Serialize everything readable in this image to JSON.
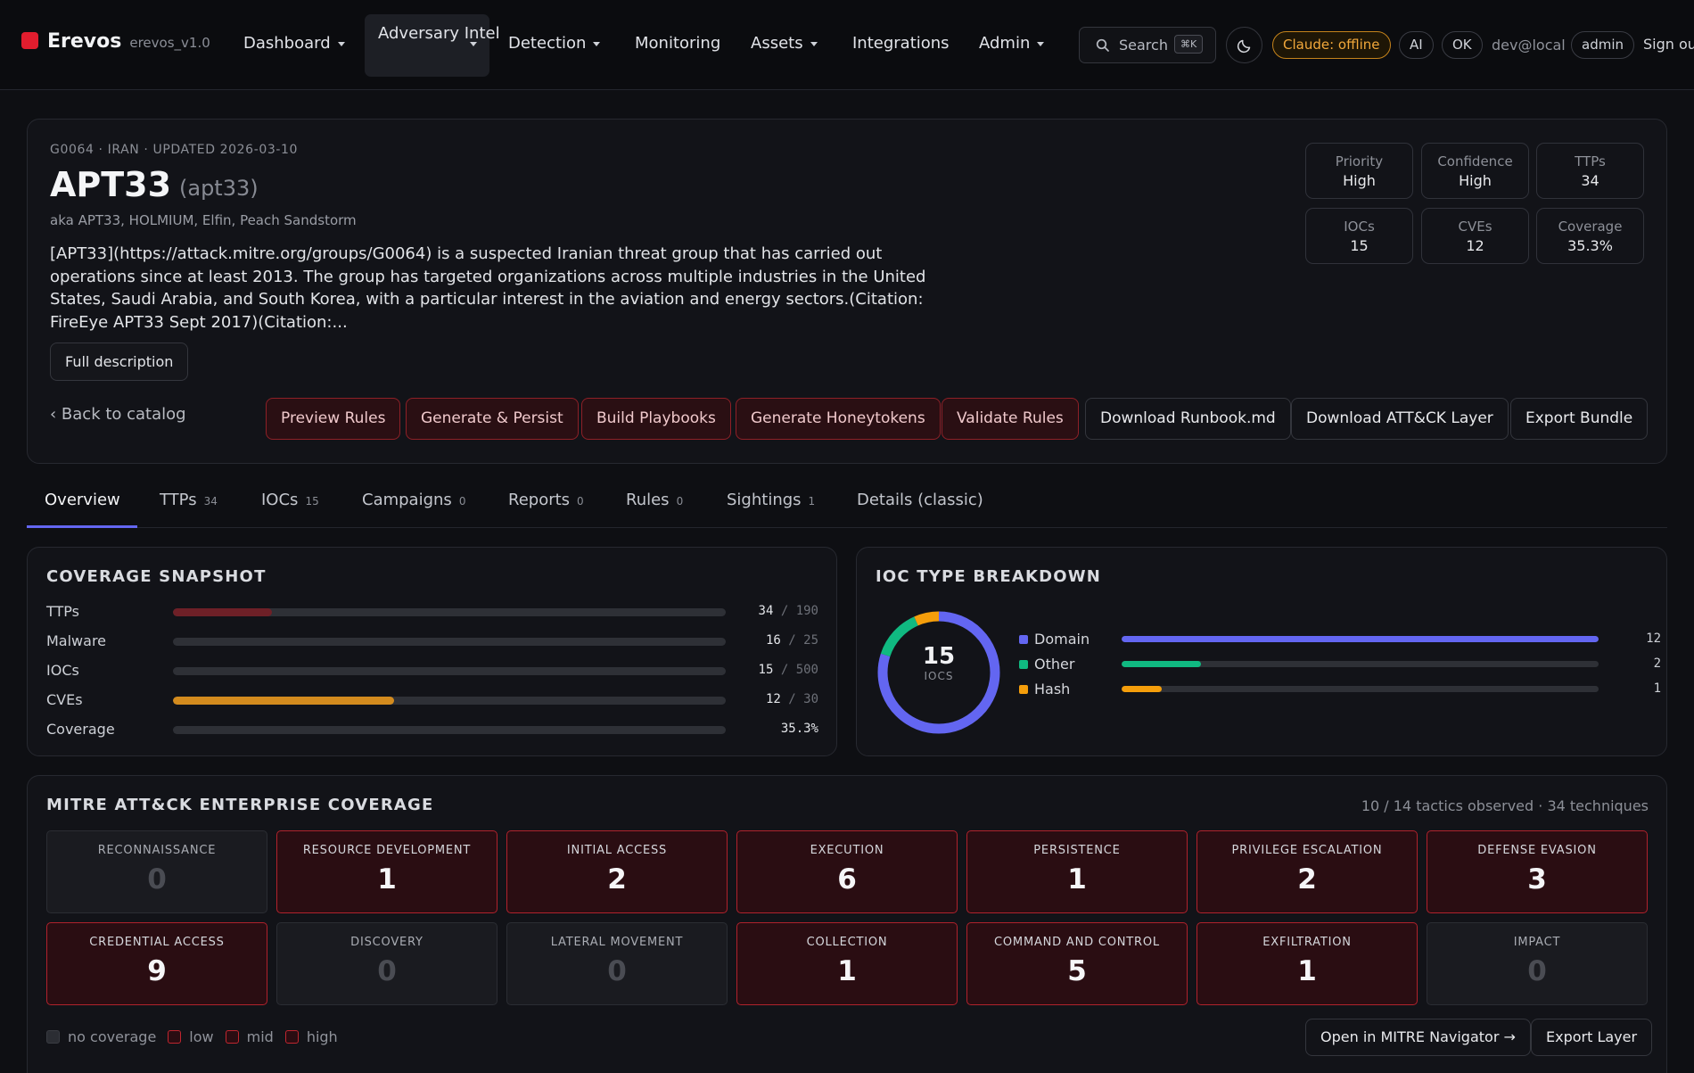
{
  "nav": {
    "brand": "Erevos",
    "version": "erevos_v1.0",
    "items": [
      {
        "label": "Dashboard"
      },
      {
        "label": "Adversary Intel"
      },
      {
        "label": "Detection"
      },
      {
        "label": "Monitoring"
      },
      {
        "label": "Assets"
      },
      {
        "label": "Integrations"
      },
      {
        "label": "Admin"
      }
    ],
    "search_label": "Search",
    "search_kbd": "⌘K",
    "claude_status": "Claude: offline",
    "ai_label": "AI",
    "ok_label": "OK",
    "user": "dev@local",
    "role": "admin",
    "signout": "Sign ou"
  },
  "actor": {
    "meta": "G0064 · IRAN · UPDATED 2026-03-10",
    "name": "APT33",
    "slug": "(apt33)",
    "aka": "aka APT33, HOLMIUM, Elfin, Peach Sandstorm",
    "description": "[APT33](https://attack.mitre.org/groups/G0064) is a suspected Iranian threat group that has carried out operations since at least 2013. The group has targeted organizations across multiple industries in the United States, Saudi Arabia, and South Korea, with a particular interest in the aviation and energy sectors.(Citation: FireEye APT33 Sept 2017)(Citation:...",
    "full_desc_label": "Full description",
    "back_label": "‹ Back to catalog",
    "stats": [
      {
        "label": "Priority",
        "value": "High"
      },
      {
        "label": "Confidence",
        "value": "High"
      },
      {
        "label": "TTPs",
        "value": "34"
      },
      {
        "label": "IOCs",
        "value": "15"
      },
      {
        "label": "CVEs",
        "value": "12"
      },
      {
        "label": "Coverage",
        "value": "35.3%"
      }
    ],
    "actions": [
      {
        "label": "Preview Rules"
      },
      {
        "label": "Generate & Persist"
      },
      {
        "label": "Build Playbooks"
      },
      {
        "label": "Generate Honeytokens"
      },
      {
        "label": "Validate Rules"
      },
      {
        "label": "Download Runbook.md"
      },
      {
        "label": "Download ATT&CK Layer"
      },
      {
        "label": "Export Bundle"
      }
    ]
  },
  "tabs": [
    {
      "label": "Overview",
      "count": ""
    },
    {
      "label": "TTPs",
      "count": "34"
    },
    {
      "label": "IOCs",
      "count": "15"
    },
    {
      "label": "Campaigns",
      "count": "0"
    },
    {
      "label": "Reports",
      "count": "0"
    },
    {
      "label": "Rules",
      "count": "0"
    },
    {
      "label": "Sightings",
      "count": "1"
    },
    {
      "label": "Details (classic)",
      "count": ""
    }
  ],
  "coverage": {
    "title": "COVERAGE SNAPSHOT",
    "rows": [
      {
        "label": "TTPs",
        "value": "34",
        "sep": "/",
        "total": "190",
        "fraction": 0.179,
        "color": "#6e2027"
      },
      {
        "label": "Malware",
        "value": "16",
        "sep": "/",
        "total": "25",
        "fraction": 0,
        "color": "#6e2027"
      },
      {
        "label": "IOCs",
        "value": "15",
        "sep": "/",
        "total": "500",
        "fraction": 0,
        "color": "#6e2027"
      },
      {
        "label": "CVEs",
        "value": "12",
        "sep": "/",
        "total": "30",
        "fraction": 0.4,
        "color": "#d38b1e"
      },
      {
        "label": "Coverage",
        "value": "35.3%",
        "sep": "",
        "total": "",
        "fraction": 0,
        "color": "#6e2027"
      }
    ]
  },
  "ioc": {
    "title": "IOC TYPE BREAKDOWN",
    "total": "15",
    "total_label": "IOCS",
    "types": [
      {
        "label": "Domain",
        "count": 12,
        "color": "#6366f1"
      },
      {
        "label": "Other",
        "count": 2,
        "color": "#10b981"
      },
      {
        "label": "Hash",
        "count": 1,
        "color": "#f59e0b"
      }
    ]
  },
  "mitre": {
    "title": "MITRE ATT&CK ENTERPRISE COVERAGE",
    "summary": "10 / 14 tactics observed · 34 techniques",
    "tactics": [
      {
        "name": "RECONNAISSANCE",
        "count": "0"
      },
      {
        "name": "RESOURCE DEVELOPMENT",
        "count": "1"
      },
      {
        "name": "INITIAL ACCESS",
        "count": "2"
      },
      {
        "name": "EXECUTION",
        "count": "6"
      },
      {
        "name": "PERSISTENCE",
        "count": "1"
      },
      {
        "name": "PRIVILEGE ESCALATION",
        "count": "2"
      },
      {
        "name": "DEFENSE EVASION",
        "count": "3"
      },
      {
        "name": "CREDENTIAL ACCESS",
        "count": "9"
      },
      {
        "name": "DISCOVERY",
        "count": "0"
      },
      {
        "name": "LATERAL MOVEMENT",
        "count": "0"
      },
      {
        "name": "COLLECTION",
        "count": "1"
      },
      {
        "name": "COMMAND AND CONTROL",
        "count": "5"
      },
      {
        "name": "EXFILTRATION",
        "count": "1"
      },
      {
        "name": "IMPACT",
        "count": "0"
      }
    ],
    "legend": [
      {
        "label": "no coverage",
        "color": "#2b2d33",
        "border": "#3a3c43"
      },
      {
        "label": "low",
        "color": "#2a0d12",
        "border": "#c0262f"
      },
      {
        "label": "mid",
        "color": "#2a0d12",
        "border": "#c0262f"
      },
      {
        "label": "high",
        "color": "#2a0d12",
        "border": "#c0262f"
      }
    ],
    "navigator_label": "Open in MITRE Navigator →",
    "export_label": "Export Layer"
  }
}
